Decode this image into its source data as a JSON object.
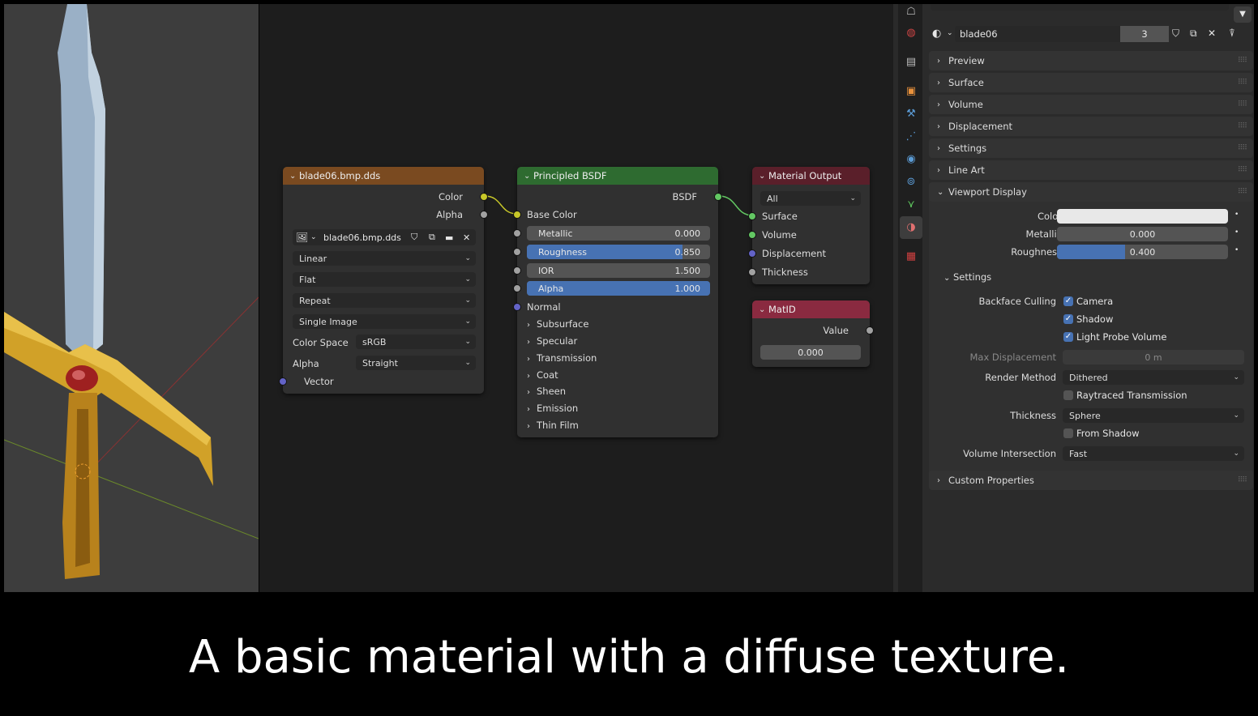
{
  "caption": "A basic material with a diffuse texture.",
  "texture_node": {
    "title": "blade06.bmp.dds",
    "out_color": "Color",
    "out_alpha": "Alpha",
    "image_name": "blade06.bmp.dds",
    "interpolation": "Linear",
    "projection": "Flat",
    "extension": "Repeat",
    "source": "Single Image",
    "color_space_label": "Color Space",
    "color_space": "sRGB",
    "alpha_label": "Alpha",
    "alpha_mode": "Straight",
    "vector": "Vector"
  },
  "bsdf_node": {
    "title": "Principled BSDF",
    "out": "BSDF",
    "base_color": "Base Color",
    "metallic": {
      "label": "Metallic",
      "value": "0.000",
      "fraction": 0.0
    },
    "roughness": {
      "label": "Roughness",
      "value": "0.850",
      "fraction": 0.85
    },
    "ior": {
      "label": "IOR",
      "value": "1.500",
      "fraction": 0.0
    },
    "alpha": {
      "label": "Alpha",
      "value": "1.000",
      "fraction": 1.0
    },
    "normal": "Normal",
    "subpanels": [
      "Subsurface",
      "Specular",
      "Transmission",
      "Coat",
      "Sheen",
      "Emission",
      "Thin Film"
    ]
  },
  "output_node": {
    "title": "Material Output",
    "target": "All",
    "inputs": [
      "Surface",
      "Volume",
      "Displacement",
      "Thickness"
    ]
  },
  "matid_node": {
    "title": "MatID",
    "out": "Value",
    "value": "0.000"
  },
  "properties": {
    "material_name": "blade06",
    "users": "3",
    "panels": [
      "Preview",
      "Surface",
      "Volume",
      "Displacement",
      "Settings",
      "Line Art"
    ],
    "viewport_display": {
      "title": "Viewport Display",
      "color_label": "Color",
      "color": "#e8e8e8",
      "metallic_label": "Metallic",
      "metallic": "0.000",
      "metallic_fraction": 0.0,
      "roughness_label": "Roughness",
      "roughness": "0.400",
      "roughness_fraction": 0.4,
      "settings_title": "Settings",
      "backface_label": "Backface Culling",
      "camera": "Camera",
      "shadow": "Shadow",
      "light_probe": "Light Probe Volume",
      "max_disp_label": "Max Displacement",
      "max_disp": "0 m",
      "render_method_label": "Render Method",
      "render_method": "Dithered",
      "raytraced": "Raytraced Transmission",
      "thickness_label": "Thickness",
      "thickness": "Sphere",
      "from_shadow": "From Shadow",
      "vol_int_label": "Volume Intersection",
      "vol_int": "Fast"
    },
    "custom_props": "Custom Properties"
  },
  "colors": {
    "texture_header": "#7a4a20",
    "bsdf_header": "#2e6b30",
    "output_header": "#5a1f2a",
    "matid_header": "#8a2a40",
    "socket_color": "#c7c729",
    "socket_shader": "#63c763",
    "socket_vector": "#6363c7",
    "socket_float": "#a1a1a1"
  }
}
